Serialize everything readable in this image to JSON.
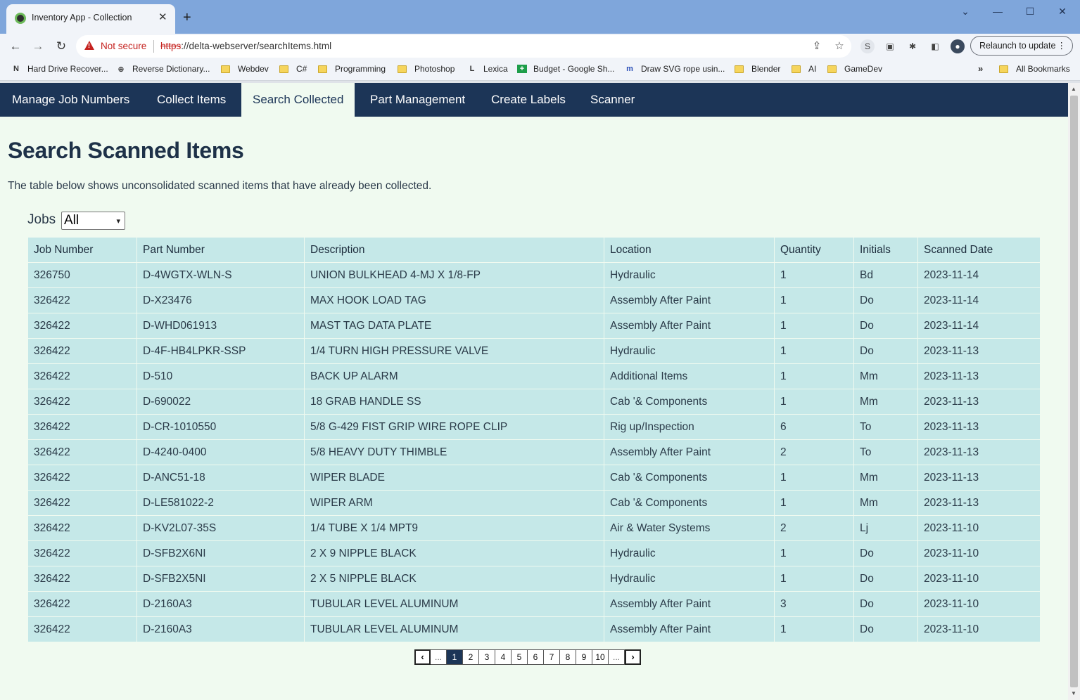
{
  "browser": {
    "tab_title": "Inventory App - Collection",
    "url_protocol": "https",
    "url_rest": "://delta-webserver/searchItems.html",
    "security_label": "Not secure",
    "relaunch_label": "Relaunch to update",
    "bookmarks": [
      {
        "label": "Hard Drive Recover...",
        "icon": "onenote-icon"
      },
      {
        "label": "Reverse Dictionary...",
        "icon": "search-globe-icon"
      },
      {
        "label": "Webdev",
        "icon": "folder-icon"
      },
      {
        "label": "C#",
        "icon": "folder-icon"
      },
      {
        "label": "Programming",
        "icon": "folder-icon"
      },
      {
        "label": "Photoshop",
        "icon": "folder-icon"
      },
      {
        "label": "Lexica",
        "icon": "lexica-icon"
      },
      {
        "label": "Budget - Google Sh...",
        "icon": "sheets-icon"
      },
      {
        "label": "Draw SVG rope usin...",
        "icon": "mm-icon"
      },
      {
        "label": "Blender",
        "icon": "folder-icon"
      },
      {
        "label": "AI",
        "icon": "folder-icon"
      },
      {
        "label": "GameDev",
        "icon": "folder-icon"
      }
    ],
    "all_bookmarks_label": "All Bookmarks"
  },
  "nav": {
    "items": [
      {
        "label": "Manage Job Numbers",
        "active": false
      },
      {
        "label": "Collect Items",
        "active": false
      },
      {
        "label": "Search Collected",
        "active": true
      },
      {
        "label": "Part Management",
        "active": false
      },
      {
        "label": "Create Labels",
        "active": false
      },
      {
        "label": "Scanner",
        "active": false
      }
    ]
  },
  "page": {
    "title": "Search Scanned Items",
    "description": "The table below shows unconsolidated scanned items that have already been collected.",
    "jobs_label": "Jobs",
    "jobs_selected": "All"
  },
  "table": {
    "columns": [
      "Job Number",
      "Part Number",
      "Description",
      "Location",
      "Quantity",
      "Initials",
      "Scanned Date"
    ],
    "rows": [
      [
        "326750",
        "D-4WGTX-WLN-S",
        "UNION BULKHEAD 4-MJ X 1/8-FP",
        "Hydraulic",
        "1",
        "Bd",
        "2023-11-14"
      ],
      [
        "326422",
        "D-X23476",
        "MAX HOOK LOAD TAG",
        "Assembly After Paint",
        "1",
        "Do",
        "2023-11-14"
      ],
      [
        "326422",
        "D-WHD061913",
        "MAST TAG DATA PLATE",
        "Assembly After Paint",
        "1",
        "Do",
        "2023-11-14"
      ],
      [
        "326422",
        "D-4F-HB4LPKR-SSP",
        "1/4 TURN HIGH PRESSURE VALVE",
        "Hydraulic",
        "1",
        "Do",
        "2023-11-13"
      ],
      [
        "326422",
        "D-510",
        "BACK UP ALARM",
        "Additional Items",
        "1",
        "Mm",
        "2023-11-13"
      ],
      [
        "326422",
        "D-690022",
        "18 GRAB HANDLE SS",
        "Cab '& Components",
        "1",
        "Mm",
        "2023-11-13"
      ],
      [
        "326422",
        "D-CR-1010550",
        "5/8 G-429 FIST GRIP WIRE ROPE CLIP",
        "Rig up/Inspection",
        "6",
        "To",
        "2023-11-13"
      ],
      [
        "326422",
        "D-4240-0400",
        "5/8 HEAVY DUTY THIMBLE",
        "Assembly After Paint",
        "2",
        "To",
        "2023-11-13"
      ],
      [
        "326422",
        "D-ANC51-18",
        "WIPER BLADE",
        "Cab '& Components",
        "1",
        "Mm",
        "2023-11-13"
      ],
      [
        "326422",
        "D-LE581022-2",
        "WIPER ARM",
        "Cab '& Components",
        "1",
        "Mm",
        "2023-11-13"
      ],
      [
        "326422",
        "D-KV2L07-35S",
        "1/4 TUBE X 1/4 MPT9",
        "Air & Water Systems",
        "2",
        "Lj",
        "2023-11-10"
      ],
      [
        "326422",
        "D-SFB2X6NI",
        "2 X 9 NIPPLE BLACK",
        "Hydraulic",
        "1",
        "Do",
        "2023-11-10"
      ],
      [
        "326422",
        "D-SFB2X5NI",
        "2 X 5 NIPPLE BLACK",
        "Hydraulic",
        "1",
        "Do",
        "2023-11-10"
      ],
      [
        "326422",
        "D-2160A3",
        "TUBULAR LEVEL ALUMINUM",
        "Assembly After Paint",
        "3",
        "Do",
        "2023-11-10"
      ],
      [
        "326422",
        "D-2160A3",
        "TUBULAR LEVEL ALUMINUM",
        "Assembly After Paint",
        "1",
        "Do",
        "2023-11-10"
      ]
    ]
  },
  "pager": {
    "prev": "‹",
    "next": "›",
    "items": [
      "...",
      "1",
      "2",
      "3",
      "4",
      "5",
      "6",
      "7",
      "8",
      "9",
      "10",
      "..."
    ],
    "current": "1"
  },
  "colors": {
    "nav_bg": "#1c3557",
    "page_bg": "#f0faf0",
    "table_cell": "#c5e8e8",
    "chrome_tabstrip": "#7fa6db"
  }
}
